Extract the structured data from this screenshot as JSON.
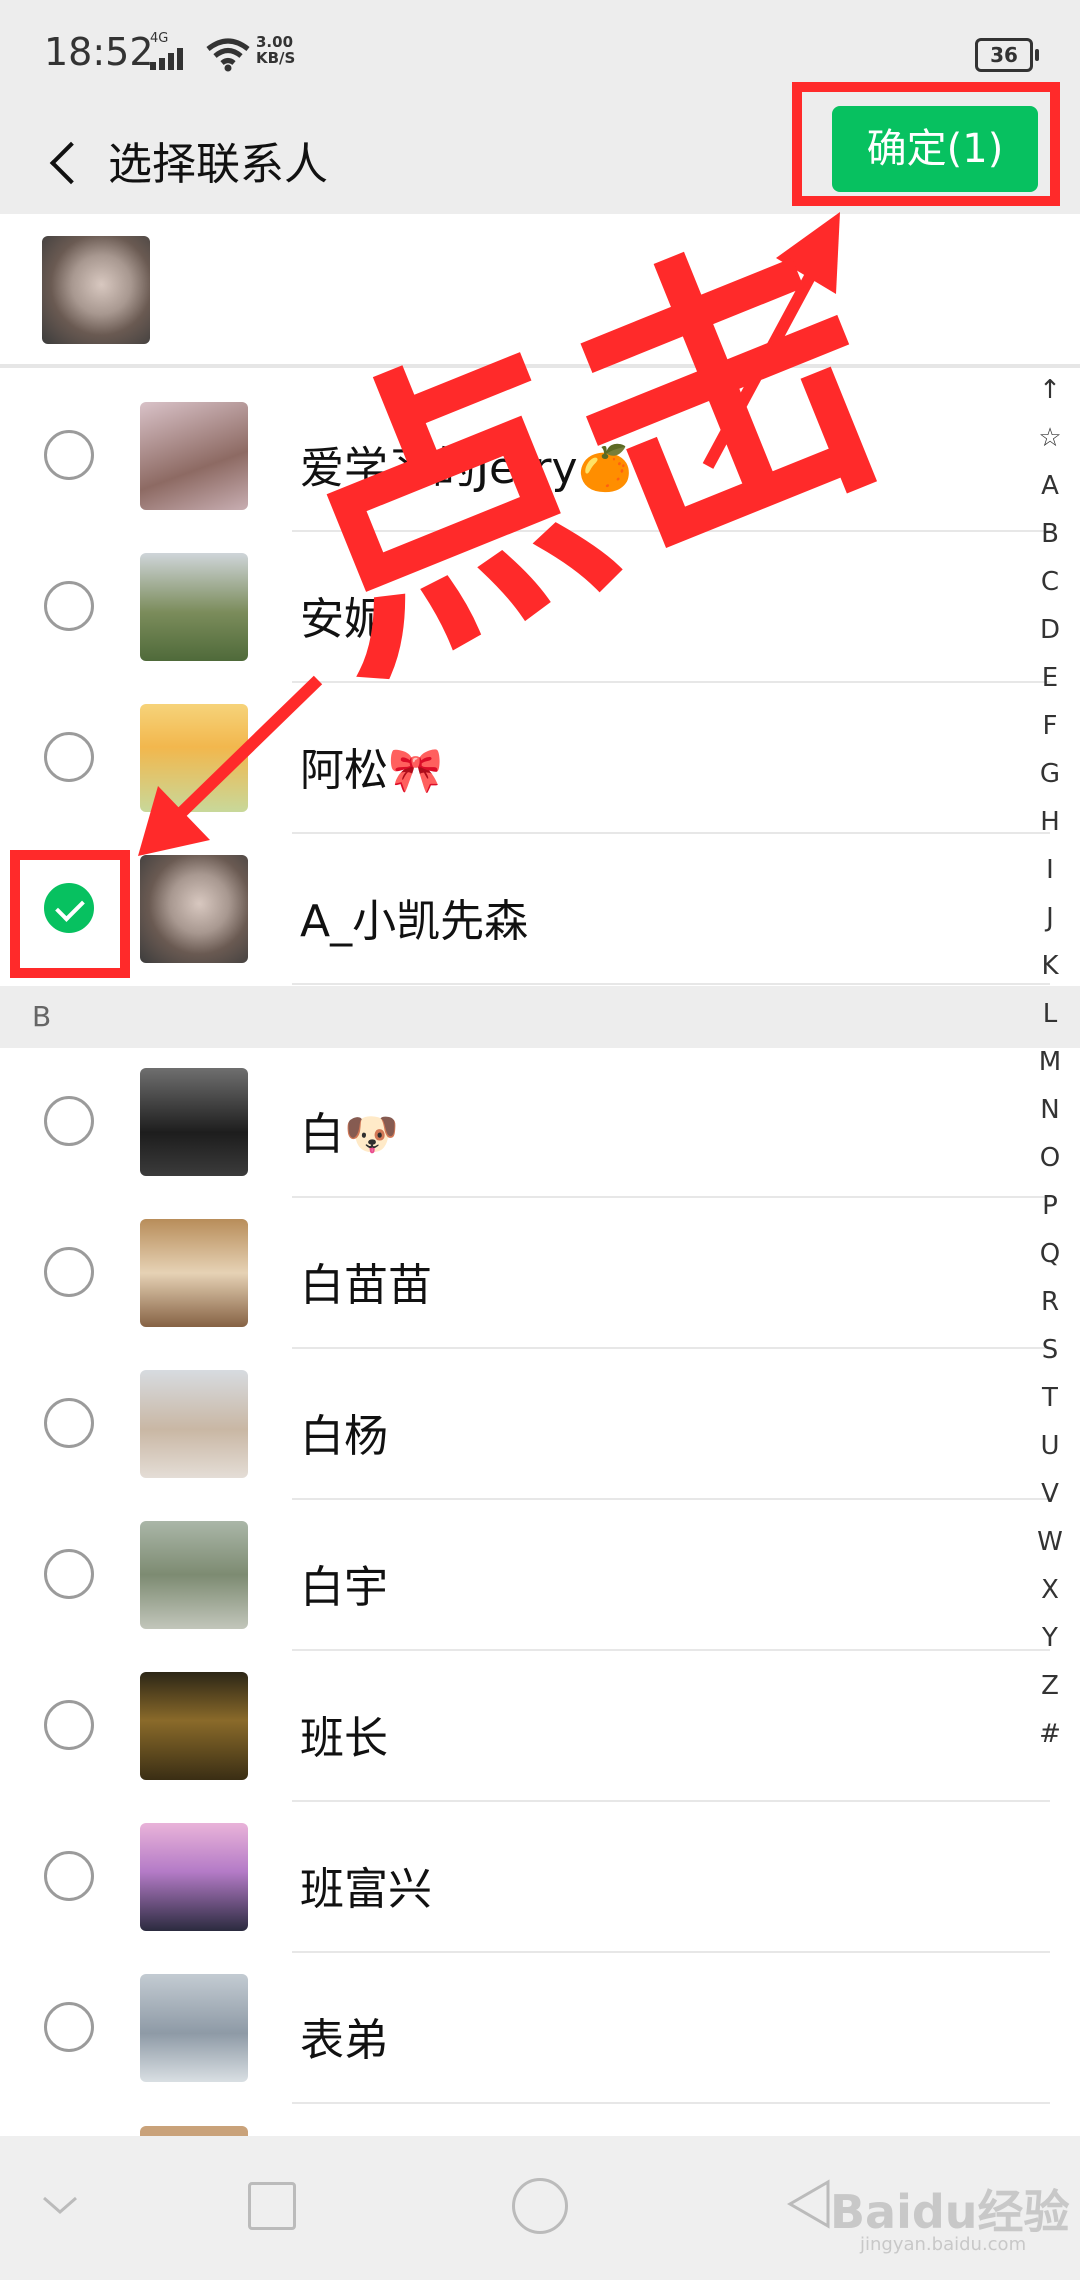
{
  "status": {
    "time": "18:52",
    "network": "4G",
    "speed_value": "3.00",
    "speed_unit": "KB/S",
    "battery": "36"
  },
  "header": {
    "title": "选择联系人",
    "confirm_label": "确定(1)"
  },
  "annotation": {
    "text": "点击",
    "color": "#ff2a2a"
  },
  "colors": {
    "accent": "#07c160"
  },
  "contacts_a": [
    {
      "name": "爱学习的Jerry🍊",
      "checked": false
    },
    {
      "name": "安妮",
      "checked": false
    },
    {
      "name": "阿松🎀",
      "checked": false
    },
    {
      "name": "A_小凯先森",
      "checked": true
    }
  ],
  "section_b": {
    "letter": "B"
  },
  "contacts_b": [
    {
      "name": "白🐶",
      "checked": false
    },
    {
      "name": "白苗苗",
      "checked": false
    },
    {
      "name": "白杨",
      "checked": false
    },
    {
      "name": "白宇",
      "checked": false
    },
    {
      "name": "班长",
      "checked": false
    },
    {
      "name": "班富兴",
      "checked": false
    },
    {
      "name": "表弟",
      "checked": false
    }
  ],
  "index_letters": [
    "↑",
    "☆",
    "A",
    "B",
    "C",
    "D",
    "E",
    "F",
    "G",
    "H",
    "I",
    "J",
    "K",
    "L",
    "M",
    "N",
    "O",
    "P",
    "Q",
    "R",
    "S",
    "T",
    "U",
    "V",
    "W",
    "X",
    "Y",
    "Z",
    "#"
  ],
  "watermark": {
    "text": "Baidu经验",
    "subtext": "jingyan.baidu.com"
  }
}
